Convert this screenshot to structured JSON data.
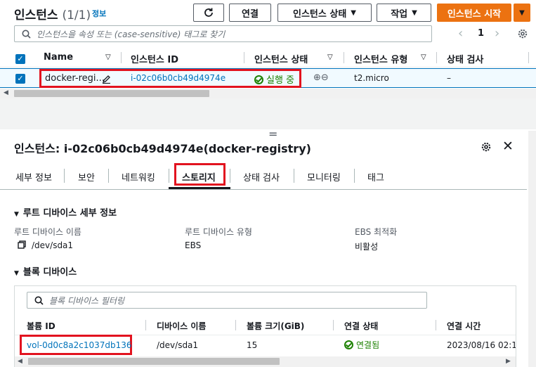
{
  "header": {
    "title": "인스턴스",
    "count": "(1/1)",
    "info_link": "정보",
    "refresh_icon": "refresh-icon",
    "connect_label": "연결",
    "instance_state_label": "인스턴스 상태",
    "actions_label": "작업",
    "launch_label": "인스턴스 시작"
  },
  "search": {
    "placeholder": "인스턴스을 속성 또는 (case-sensitive) 태그로 찾기",
    "page_number": "1"
  },
  "table": {
    "columns": [
      "Name",
      "인스턴스 ID",
      "인스턴스 상태",
      "인스턴스 유형",
      "상태 검사"
    ],
    "row": {
      "name": "docker-regi...",
      "instance_id": "i-02c06b0cb49d4974e",
      "state": "실행 중",
      "type": "t2.micro",
      "status_check": "–"
    }
  },
  "detail": {
    "divider": "=",
    "title": "인스턴스: i-02c06b0cb49d4974e(docker-registry)",
    "tabs": [
      "세부 정보",
      "보안",
      "네트워킹",
      "스토리지",
      "상태 검사",
      "모니터링",
      "태그"
    ],
    "active_tab": "스토리지",
    "root_section": "루트 디바이스 세부 정보",
    "root_name_label": "루트 디바이스 이름",
    "root_name_value": "/dev/sda1",
    "root_type_label": "루트 디바이스 유형",
    "root_type_value": "EBS",
    "ebs_opt_label": "EBS 최적화",
    "ebs_opt_value": "비활성",
    "block_section": "블록 디바이스",
    "block_search_placeholder": "블록 디바이스 필터링",
    "block_columns": [
      "볼륨 ID",
      "디바이스 이름",
      "볼륨 크기(GiB)",
      "연결 상태",
      "연결 시간"
    ],
    "block_row": {
      "volume_id": "vol-0d0c8a2c1037db136",
      "device": "/dev/sda1",
      "size": "15",
      "attach_state": "연결됨",
      "attach_time": "2023/08/16 02:1"
    }
  },
  "colors": {
    "accent": "#0073bb",
    "launch_orange": "#ec7211",
    "running_green": "#1d8102",
    "highlight_red": "#e2131f"
  }
}
